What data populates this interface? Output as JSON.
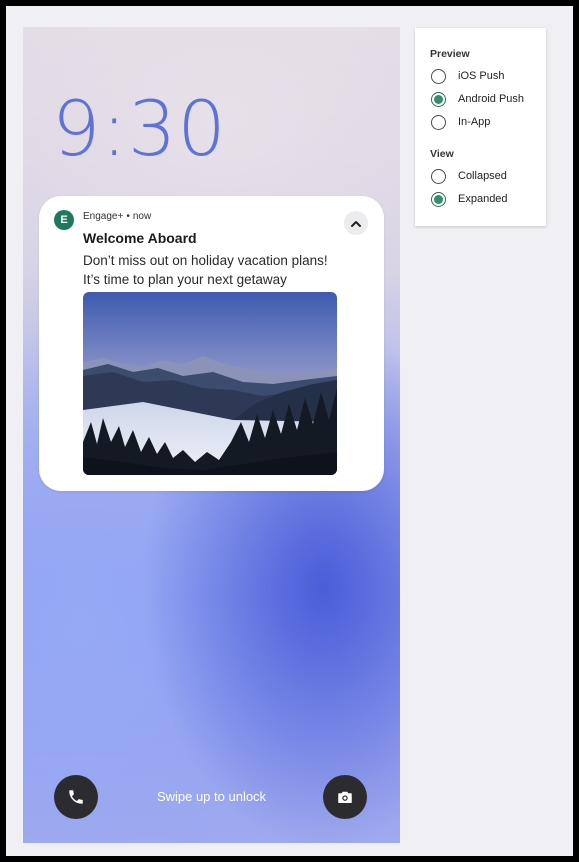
{
  "lockscreen": {
    "time": "9:30",
    "swipe_hint": "Swipe up to unlock",
    "phone_icon": "phone-icon",
    "camera_icon": "camera-icon"
  },
  "notification": {
    "app_initial": "E",
    "app_name": "Engage+",
    "separator": "•",
    "timestamp": "now",
    "title": "Welcome Aboard",
    "body_line1": "Don’t miss out on holiday vacation plans!",
    "body_line2": "It’s time to plan your next getaway",
    "collapse_icon": "chevron-up-icon",
    "accent_color": "#1d7a5f"
  },
  "preview_panel": {
    "preview_heading": "Preview",
    "preview_options": [
      {
        "label": "iOS Push",
        "selected": false
      },
      {
        "label": "Android Push",
        "selected": true
      },
      {
        "label": "In-App",
        "selected": false
      }
    ],
    "view_heading": "View",
    "view_options": [
      {
        "label": "Collapsed",
        "selected": false
      },
      {
        "label": "Expanded",
        "selected": true
      }
    ],
    "selected_color": "#2f8f6f"
  }
}
